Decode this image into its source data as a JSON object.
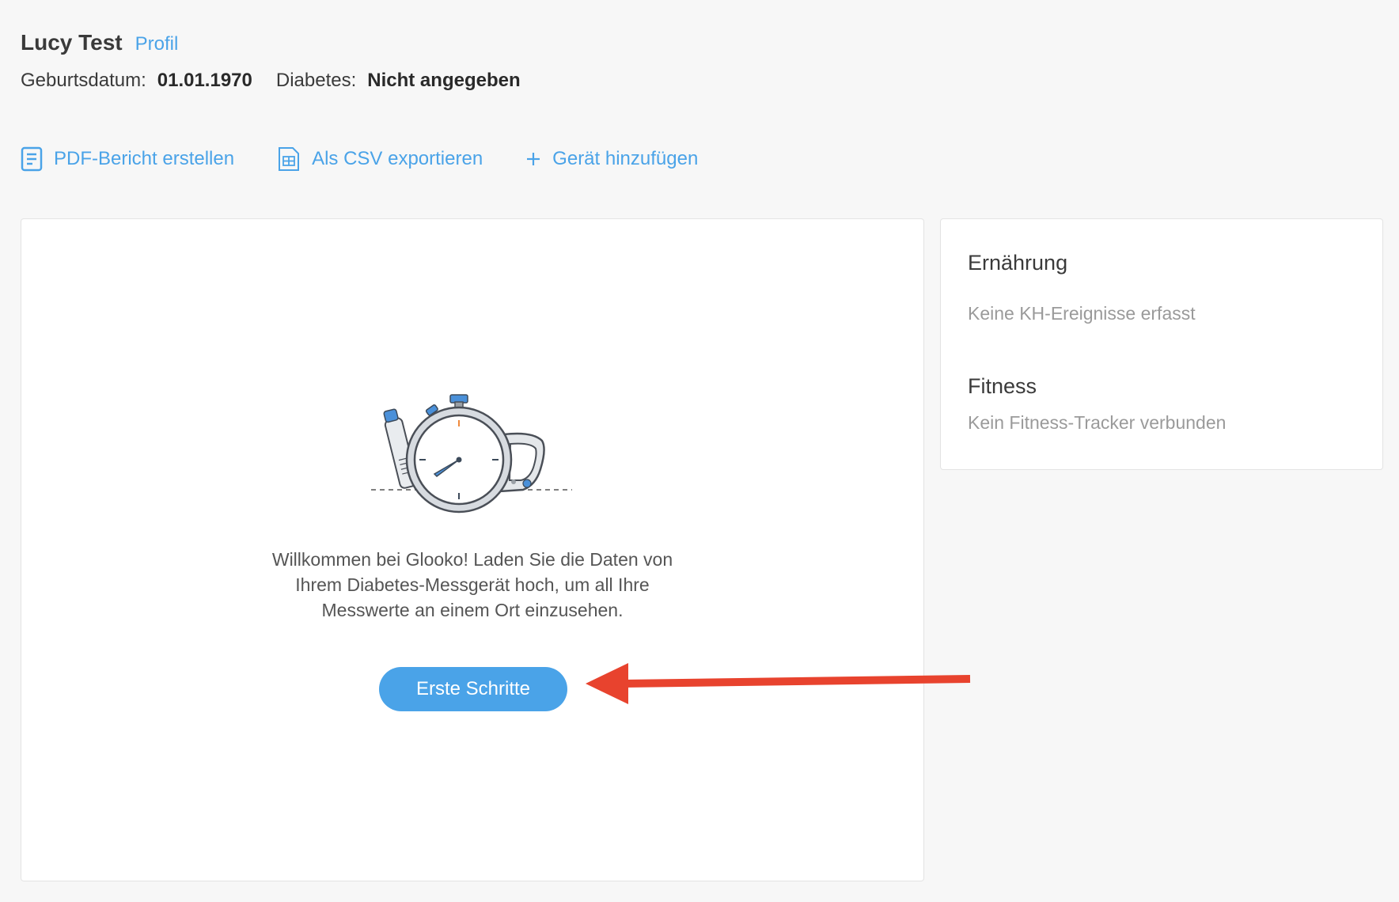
{
  "header": {
    "patient_name": "Lucy Test",
    "profile_link": "Profil",
    "birthdate_label": "Geburtsdatum:",
    "birthdate_value": "01.01.1970",
    "diabetes_label": "Diabetes:",
    "diabetes_value": "Nicht angegeben"
  },
  "actions": {
    "pdf_label": "PDF-Bericht erstellen",
    "csv_label": "Als CSV exportieren",
    "add_device_label": "Gerät hinzufügen",
    "pdf_icon": "document-icon",
    "csv_icon": "table-file-icon",
    "add_icon": "plus-icon"
  },
  "main": {
    "illustration_icon": "stopwatch-devices-illustration",
    "welcome_text": "Willkommen bei Glooko! Laden Sie die Daten von Ihrem Diabetes-Messgerät hoch, um all Ihre Messwerte an einem Ort einzusehen.",
    "cta_label": "Erste Schritte"
  },
  "sidebar": {
    "nutrition_title": "Ernährung",
    "nutrition_text": "Keine KH-Ereignisse erfasst",
    "fitness_title": "Fitness",
    "fitness_text": "Kein Fitness-Tracker verbunden"
  },
  "colors": {
    "accent": "#4aa3e8",
    "annotation": "#e8432e",
    "background": "#f7f7f7"
  }
}
